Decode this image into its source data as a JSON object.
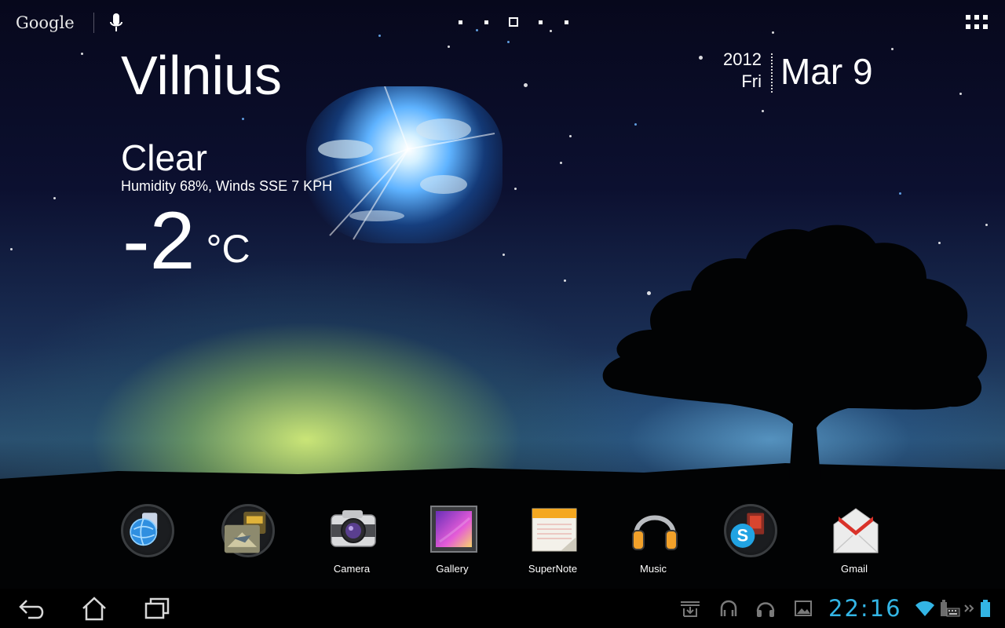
{
  "search": {
    "label": "Google"
  },
  "weather": {
    "city": "Vilnius",
    "condition": "Clear",
    "details": "Humidity 68%, Winds SSE 7 KPH",
    "temperature": "-2",
    "unit": "°C"
  },
  "date": {
    "year": "2012",
    "weekday": "Fri",
    "month_day": "Mar 9"
  },
  "pages": {
    "count": 5,
    "active": 3
  },
  "dock": {
    "apps": [
      {
        "label": "",
        "icon": "browser-folder-icon"
      },
      {
        "label": "",
        "icon": "games-folder-icon"
      },
      {
        "label": "Camera",
        "icon": "camera-icon"
      },
      {
        "label": "Gallery",
        "icon": "gallery-icon"
      },
      {
        "label": "SuperNote",
        "icon": "supernote-icon"
      },
      {
        "label": "Music",
        "icon": "headphones-icon"
      },
      {
        "label": "",
        "icon": "skype-folder-icon"
      },
      {
        "label": "Gmail",
        "icon": "gmail-icon"
      }
    ]
  },
  "status": {
    "time": "22:16",
    "accent_color": "#33b5e5"
  }
}
